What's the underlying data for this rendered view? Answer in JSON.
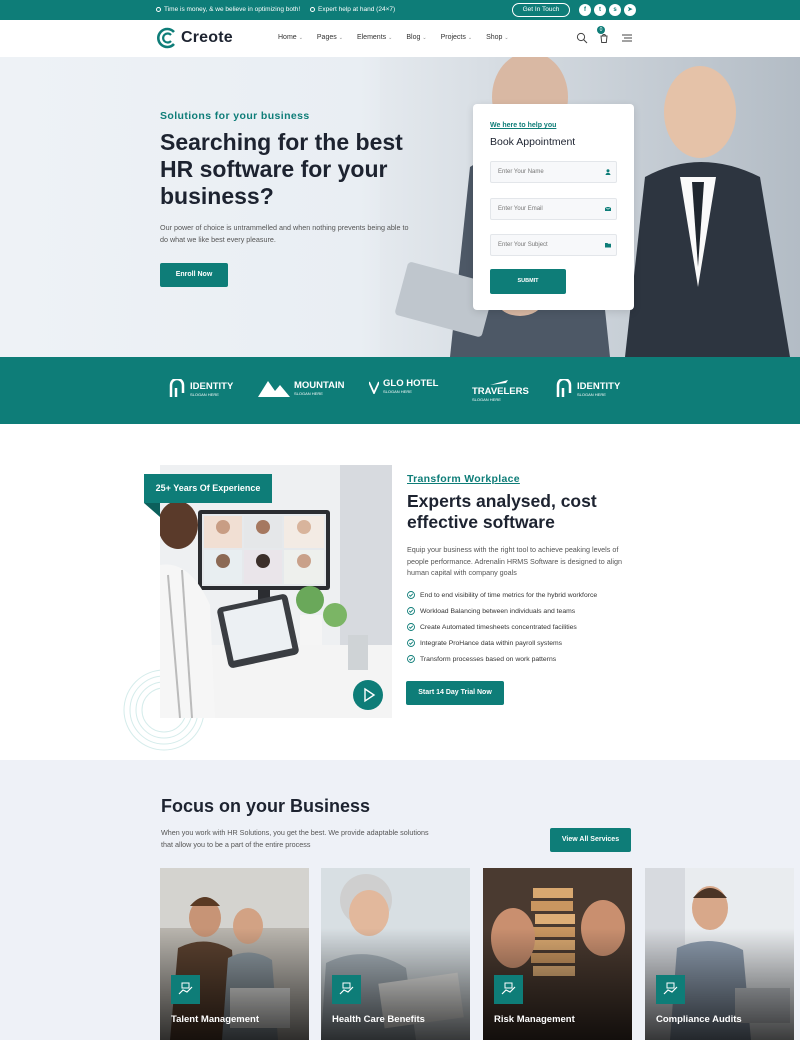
{
  "topbar": {
    "message1": "Time is money, & we believe in optimizing both!",
    "message2": "Expert help at hand (24×7)",
    "get_in_touch": "Get In Touch",
    "social": [
      {
        "icon": "facebook-icon",
        "glyph": "f"
      },
      {
        "icon": "twitter-icon",
        "glyph": "t"
      },
      {
        "icon": "skype-icon",
        "glyph": "s"
      },
      {
        "icon": "telegram-icon",
        "glyph": "➤"
      }
    ]
  },
  "header": {
    "brand": "Creote",
    "nav": [
      "Home",
      "Pages",
      "Elements",
      "Blog",
      "Projects",
      "Shop"
    ],
    "cart_count": "0"
  },
  "hero": {
    "subtitle": "Solutions for your business",
    "title": "Searching for the best HR software for your business?",
    "description": "Our power of choice is untrammelled and when nothing prevents being able to do what we like best every pleasure.",
    "cta": "Enroll Now"
  },
  "appointment": {
    "subtitle": "We here to help you",
    "title": "Book Appointment",
    "name_placeholder": "Enter Your Name",
    "email_placeholder": "Enter Your Email",
    "subject_placeholder": "Enter Your Subject",
    "submit": "SUBMIT"
  },
  "brands": [
    {
      "name": "IDENTITY",
      "slogan": "SLOGAN HERE",
      "icon": "identity-logo-icon"
    },
    {
      "name": "MOUNTAIN",
      "slogan": "SLOGAN HERE",
      "icon": "mountain-logo-icon"
    },
    {
      "name": "GLO HOTEL",
      "slogan": "SLOGAN HERE",
      "icon": "glo-hotel-logo-icon"
    },
    {
      "name": "TRAVELERS",
      "slogan": "SLOGAN HERE",
      "icon": "travelers-logo-icon"
    },
    {
      "name": "IDENTITY",
      "slogan": "SLOGAN HERE",
      "icon": "identity-logo-icon"
    }
  ],
  "about": {
    "experience_badge": "25+ Years Of Experience",
    "subtitle": "Transform Workplace",
    "title": "Experts analysed, cost effective software",
    "description": "Equip your business with the right tool to achieve peaking levels of people performance. Adrenalin HRMS Software is designed to align human capital with company goals",
    "checklist": [
      "End to end visibility of time metrics for the hybrid workforce",
      "Workload Balancing between individuals and teams",
      "Create Automated timesheets concentrated facilities",
      "Integrate ProHance data within payroll systems",
      "Transform processes based on work patterns"
    ],
    "cta": "Start 14 Day Trial Now"
  },
  "services": {
    "title": "Focus on your Business",
    "description": "When you work with HR Solutions, you get the best. We provide adaptable solutions that allow you to be a part of the entire process",
    "cta": "View All Services",
    "cards": [
      {
        "title": "Talent Management"
      },
      {
        "title": "Health Care Benefits"
      },
      {
        "title": "Risk Management"
      },
      {
        "title": "Compliance Audits"
      }
    ]
  },
  "colors": {
    "accent": "#0e7d78",
    "dark": "#1d2330",
    "light_bg": "#eef1f7"
  }
}
